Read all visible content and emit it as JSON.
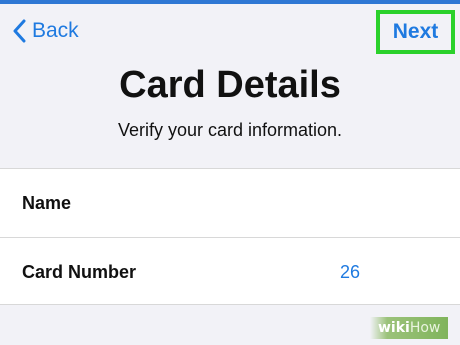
{
  "nav": {
    "back_label": "Back",
    "next_label": "Next"
  },
  "header": {
    "title": "Card Details",
    "subtitle": "Verify your card information."
  },
  "form": {
    "rows": [
      {
        "label": "Name",
        "value": ""
      },
      {
        "label": "Card Number",
        "value": "26"
      }
    ]
  },
  "watermark": {
    "part1": "wiki",
    "part2": "How"
  },
  "colors": {
    "accent": "#1f7ae0",
    "highlight": "#2bd12b",
    "background": "#f2f2f7"
  }
}
